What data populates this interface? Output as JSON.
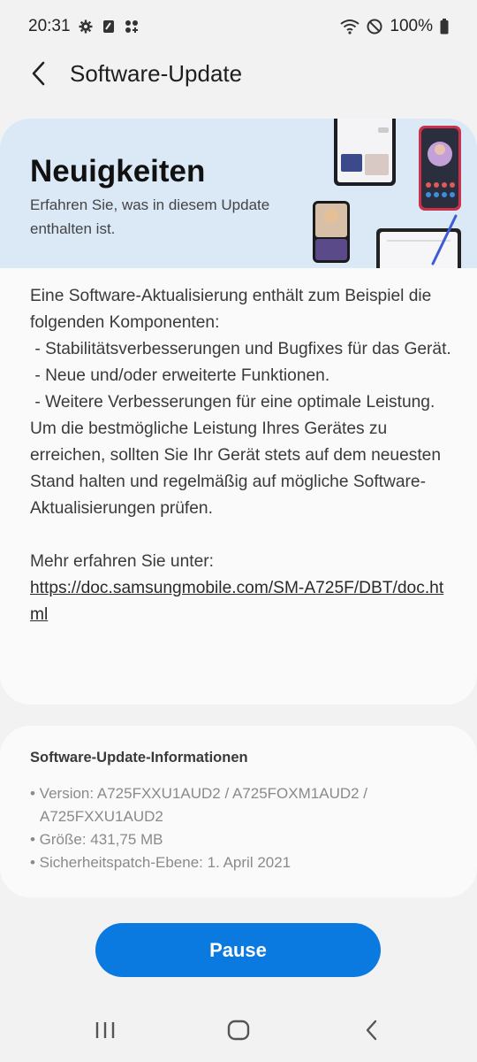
{
  "status_bar": {
    "time": "20:31",
    "battery": "100%",
    "left_icons": [
      "gear-icon",
      "sim-icon",
      "grid-icon"
    ],
    "right_icons": [
      "wifi-icon",
      "do-not-disturb-icon",
      "battery-icon"
    ]
  },
  "app_bar": {
    "title": "Software-Update"
  },
  "news": {
    "title": "Neuigkeiten",
    "subtitle": "Erfahren Sie, was in diesem Update enthalten ist.",
    "body_lines": [
      "Eine Software-Aktualisierung enthält zum Beispiel die folgenden Komponenten:",
      " - Stabilitätsverbesserungen und Bugfixes für das Gerät.",
      " - Neue und/oder erweiterte Funktionen.",
      " - Weitere Verbesserungen für eine optimale Leistung.",
      "Um die bestmögliche Leistung Ihres Gerätes zu erreichen, sollten Sie Ihr Gerät stets auf dem neuesten Stand halten und regelmäßig auf mögliche Software-Aktualisierungen prüfen."
    ],
    "more_label": "Mehr erfahren Sie unter:",
    "link": "https://doc.samsungmobile.com/SM-A725F/DBT/doc.html"
  },
  "info": {
    "title": "Software-Update-Informationen",
    "items": [
      "• Version: A725FXXU1AUD2 / A725FOXM1AUD2 / A725FXXU1AUD2",
      "• Größe: 431,75 MB",
      "• Sicherheitspatch-Ebene: 1. April 2021"
    ]
  },
  "actions": {
    "pause_label": "Pause"
  },
  "colors": {
    "accent": "#0a79e0",
    "banner": "#dbe9f7",
    "background": "#f2f2f2",
    "card": "#fafafa"
  }
}
